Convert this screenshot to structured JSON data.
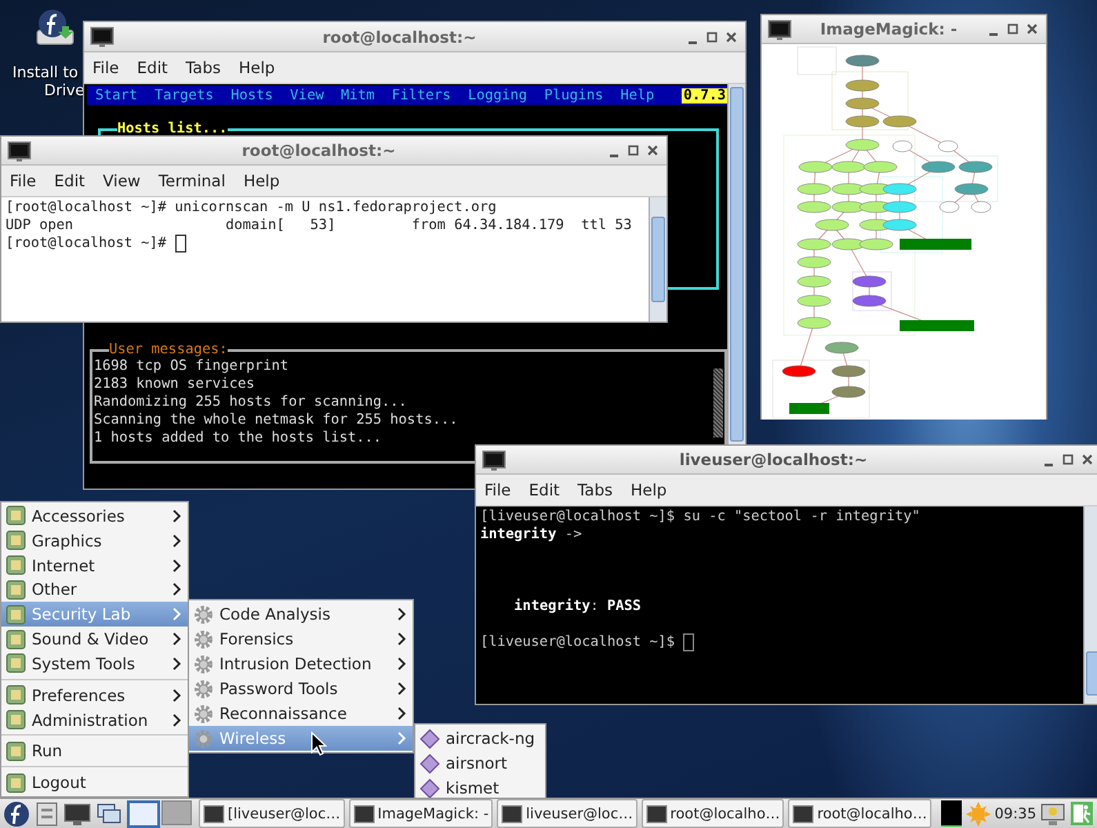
{
  "desktop": {
    "icon_label_lines": [
      "Install to",
      "Drive"
    ]
  },
  "windows": [
    {
      "kind": "ettercap",
      "title": "root@localhost:~",
      "menu": [
        "File",
        "Edit",
        "Tabs",
        "Help"
      ],
      "app_menu": [
        "Start",
        "Targets",
        "Hosts",
        "View",
        "Mitm",
        "Filters",
        "Logging",
        "Plugins",
        "Help"
      ],
      "version": "0.7.3",
      "hosts_title": "Hosts list...",
      "messages_title": "User messages:",
      "messages": [
        "1698 tcp OS fingerprint",
        "2183 known services",
        "Randomizing 255 hosts for scanning...",
        "Scanning the whole netmask for 255 hosts...",
        "1 hosts added to the hosts list..."
      ]
    },
    {
      "kind": "terminal-light",
      "title": "root@localhost:~",
      "menu": [
        "File",
        "Edit",
        "View",
        "Terminal",
        "Help"
      ],
      "lines": [
        {
          "kind": "text",
          "text": "[root@localhost ~]# unicornscan -m U ns1.fedoraproject.org"
        },
        {
          "kind": "text",
          "text": "UDP open                  domain[   53]         from 64.34.184.179  ttl 53"
        },
        {
          "kind": "prompt",
          "text": "[root@localhost ~]# "
        }
      ]
    },
    {
      "kind": "image-viewer",
      "title": "ImageMagick: -"
    },
    {
      "kind": "terminal-dark",
      "title": "liveuser@localhost:~",
      "menu": [
        "File",
        "Edit",
        "Tabs",
        "Help"
      ],
      "lines": [
        {
          "kind": "text",
          "text": "[liveuser@localhost ~]$ su -c \"sectool -r integrity\""
        },
        {
          "kind": "text",
          "text": "**integrity** ->"
        },
        {
          "kind": "blank"
        },
        {
          "kind": "blank"
        },
        {
          "kind": "blank"
        },
        {
          "kind": "text",
          "text": "    **integrity**: **PASS**"
        },
        {
          "kind": "blank"
        },
        {
          "kind": "prompt",
          "text": "[liveuser@localhost ~]$ "
        }
      ]
    }
  ],
  "start_menu": {
    "items": [
      {
        "label": "Accessories",
        "submenu": true,
        "selected": false,
        "separator_before": false
      },
      {
        "label": "Graphics",
        "submenu": true,
        "selected": false,
        "separator_before": false
      },
      {
        "label": "Internet",
        "submenu": true,
        "selected": false,
        "separator_before": false
      },
      {
        "label": "Other",
        "submenu": true,
        "selected": false,
        "separator_before": false
      },
      {
        "label": "Security Lab",
        "submenu": true,
        "selected": true,
        "separator_before": false
      },
      {
        "label": "Sound & Video",
        "submenu": true,
        "selected": false,
        "separator_before": false
      },
      {
        "label": "System Tools",
        "submenu": true,
        "selected": false,
        "separator_before": false
      },
      {
        "label": "Preferences",
        "submenu": true,
        "selected": false,
        "separator_before": true
      },
      {
        "label": "Administration",
        "submenu": true,
        "selected": false,
        "separator_before": false
      },
      {
        "label": "Run",
        "submenu": false,
        "selected": false,
        "separator_before": true
      },
      {
        "label": "Logout",
        "submenu": false,
        "selected": false,
        "separator_before": true
      }
    ]
  },
  "security_menu": {
    "items": [
      {
        "label": "Code Analysis",
        "submenu": true,
        "selected": false
      },
      {
        "label": "Forensics",
        "submenu": true,
        "selected": false
      },
      {
        "label": "Intrusion Detection",
        "submenu": true,
        "selected": false
      },
      {
        "label": "Password Tools",
        "submenu": true,
        "selected": false
      },
      {
        "label": "Reconnaissance",
        "submenu": true,
        "selected": false
      },
      {
        "label": "Wireless",
        "submenu": true,
        "selected": true
      }
    ]
  },
  "wireless_menu": {
    "items": [
      {
        "label": "aircrack-ng",
        "selected": false
      },
      {
        "label": "airsnort",
        "selected": false
      },
      {
        "label": "kismet",
        "selected": false
      }
    ]
  },
  "taskbar": {
    "workspaces": [
      {
        "selected": true
      },
      {
        "selected": false
      }
    ],
    "tasks": [
      {
        "label": "[liveuser@loc…"
      },
      {
        "label": "ImageMagick: -"
      },
      {
        "label": "liveuser@loc…"
      },
      {
        "label": "root@localho…"
      },
      {
        "label": "root@localho…"
      }
    ],
    "clock": "09:35"
  }
}
